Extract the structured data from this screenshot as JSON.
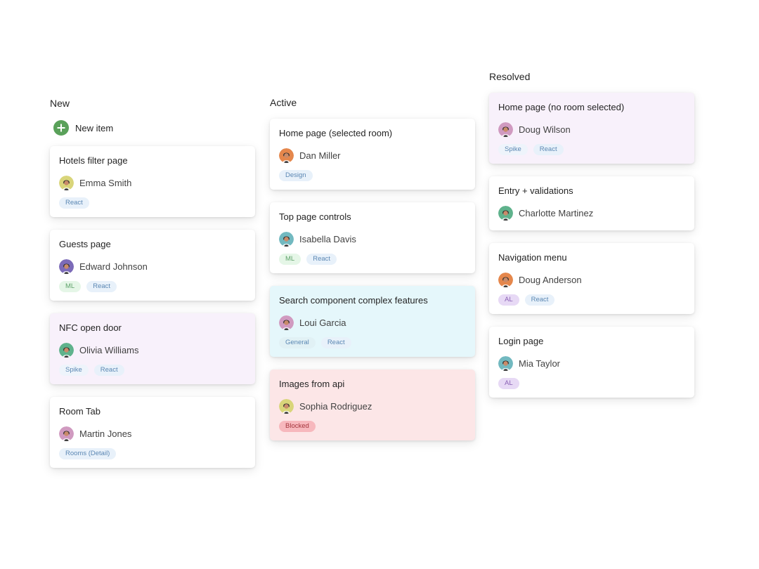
{
  "colors": {
    "new_item_accent": "#5aa15a",
    "card_default": "#ffffff",
    "card_lavender": "#f8f1fb",
    "card_cyan": "#e5f7fb",
    "card_pink": "#fce6e7"
  },
  "tag_styles": {
    "React": {
      "bg": "#e8f1fa",
      "fg": "#5b87b3"
    },
    "ML": {
      "bg": "#e5f6e7",
      "fg": "#5fa36b"
    },
    "Spike": {
      "bg": "#eef4fb",
      "fg": "#5b87b3"
    },
    "Rooms (Detail)": {
      "bg": "#e8f1fa",
      "fg": "#5b87b3"
    },
    "Design": {
      "bg": "#e8f1fa",
      "fg": "#5b87b3"
    },
    "General": {
      "bg": "#e1f1f5",
      "fg": "#5b87b3"
    },
    "Blocked": {
      "bg": "#f7b8bd",
      "fg": "#a5353d"
    },
    "AL": {
      "bg": "#e7d9f5",
      "fg": "#8a61b5"
    }
  },
  "columns": {
    "new": {
      "title": "New",
      "new_item_label": "New item",
      "new_item_icon": "plus-circle-icon",
      "cards": [
        {
          "title": "Hotels filter page",
          "assignee": "Emma Smith",
          "avatar_color": "#d9d57a",
          "tags": [
            "React"
          ],
          "bg": "#ffffff"
        },
        {
          "title": "Guests page",
          "assignee": "Edward Johnson",
          "avatar_color": "#7c6bb8",
          "tags": [
            "ML",
            "React"
          ],
          "bg": "#ffffff"
        },
        {
          "title": "NFC open door",
          "assignee": "Olivia Williams",
          "avatar_color": "#5fb28c",
          "tags": [
            "Spike",
            "React"
          ],
          "bg": "#f8f1fb"
        },
        {
          "title": "Room Tab",
          "assignee": "Martin Jones",
          "avatar_color": "#d09ac0",
          "tags": [
            "Rooms (Detail)"
          ],
          "bg": "#ffffff"
        }
      ]
    },
    "active": {
      "title": "Active",
      "cards": [
        {
          "title": "Home page (selected room)",
          "assignee": "Dan Miller",
          "avatar_color": "#e5874c",
          "tags": [
            "Design"
          ],
          "bg": "#ffffff"
        },
        {
          "title": "Top page controls",
          "assignee": "Isabella Davis",
          "avatar_color": "#72b9c0",
          "tags": [
            "ML",
            "React"
          ],
          "bg": "#ffffff"
        },
        {
          "title": "Search component complex features",
          "assignee": "Loui Garcia",
          "avatar_color": "#d09ac0",
          "tags": [
            "General",
            "React"
          ],
          "bg": "#e5f7fb"
        },
        {
          "title": "Images from api",
          "assignee": "Sophia Rodriguez",
          "avatar_color": "#d9d57a",
          "tags": [
            "Blocked"
          ],
          "bg": "#fce6e7"
        }
      ]
    },
    "resolved": {
      "title": "Resolved",
      "cards": [
        {
          "title": "Home page (no room selected)",
          "assignee": "Doug Wilson",
          "avatar_color": "#d09ac0",
          "tags": [
            "Spike",
            "React"
          ],
          "bg": "#f8f1fb"
        },
        {
          "title": "Entry + validations",
          "assignee": "Charlotte Martinez",
          "avatar_color": "#5fb28c",
          "tags": [],
          "bg": "#ffffff"
        },
        {
          "title": "Navigation menu",
          "assignee": "Doug Anderson",
          "avatar_color": "#e5874c",
          "tags": [
            "AL",
            "React"
          ],
          "bg": "#ffffff"
        },
        {
          "title": "Login page",
          "assignee": "Mia Taylor",
          "avatar_color": "#72b9c0",
          "tags": [
            "AL"
          ],
          "bg": "#ffffff"
        }
      ]
    }
  }
}
